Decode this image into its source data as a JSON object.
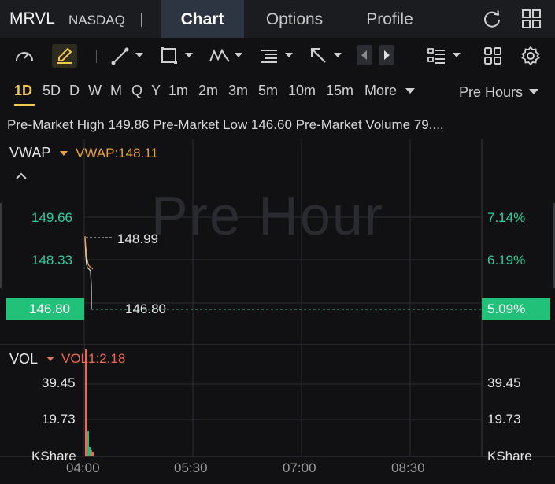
{
  "header": {
    "ticker": "MRVL",
    "exchange": "NASDAQ",
    "tabs": [
      {
        "label": "Chart",
        "active": true
      },
      {
        "label": "Options",
        "active": false
      },
      {
        "label": "Profile",
        "active": false
      }
    ],
    "icons": [
      "refresh-icon",
      "grid-menu-icon"
    ]
  },
  "toolbar": {
    "icons": [
      "speedometer-icon",
      "draw-pen-icon",
      "trendline-icon",
      "rectangle-icon",
      "pattern-icon",
      "fib-lines-icon",
      "arrow-icon",
      "scroll-left-icon",
      "scroll-right-icon",
      "layout-list-icon",
      "multi-chart-icon",
      "settings-icon"
    ]
  },
  "timeframes": {
    "items": [
      "1D",
      "5D",
      "D",
      "W",
      "M",
      "Q",
      "Y",
      "1m",
      "2m",
      "3m",
      "5m",
      "10m",
      "15m"
    ],
    "active": "1D",
    "more_label": "More",
    "session_label": "Pre Hours"
  },
  "info": {
    "text": "Pre-Market High 149.86 Pre-Market Low 146.60 Pre-Market Volume 79...."
  },
  "price_panel": {
    "indicator_name": "VWAP",
    "indicator_value": "VWAP:148.11",
    "watermark": "Pre Hour",
    "left_ticks": [
      "149.66",
      "148.33"
    ],
    "right_ticks": [
      "7.14%",
      "6.19%"
    ],
    "current_price_left": "146.80",
    "current_price_right": "5.09%",
    "high_marker": "148.99",
    "last_marker": "146.80"
  },
  "volume_panel": {
    "indicator_name": "VOL",
    "indicator_value": "VOL1:2.18",
    "left_ticks": [
      "39.45",
      "19.73",
      "KShare"
    ],
    "right_ticks": [
      "39.45",
      "19.73",
      "KShare"
    ]
  },
  "x_axis": {
    "labels": [
      "04:00",
      "05:30",
      "07:00",
      "08:30"
    ]
  },
  "colors": {
    "accent": "#f2c94c",
    "up": "#22c17a",
    "vwap": "#e8a33a",
    "vol_label": "#f2674f"
  }
}
